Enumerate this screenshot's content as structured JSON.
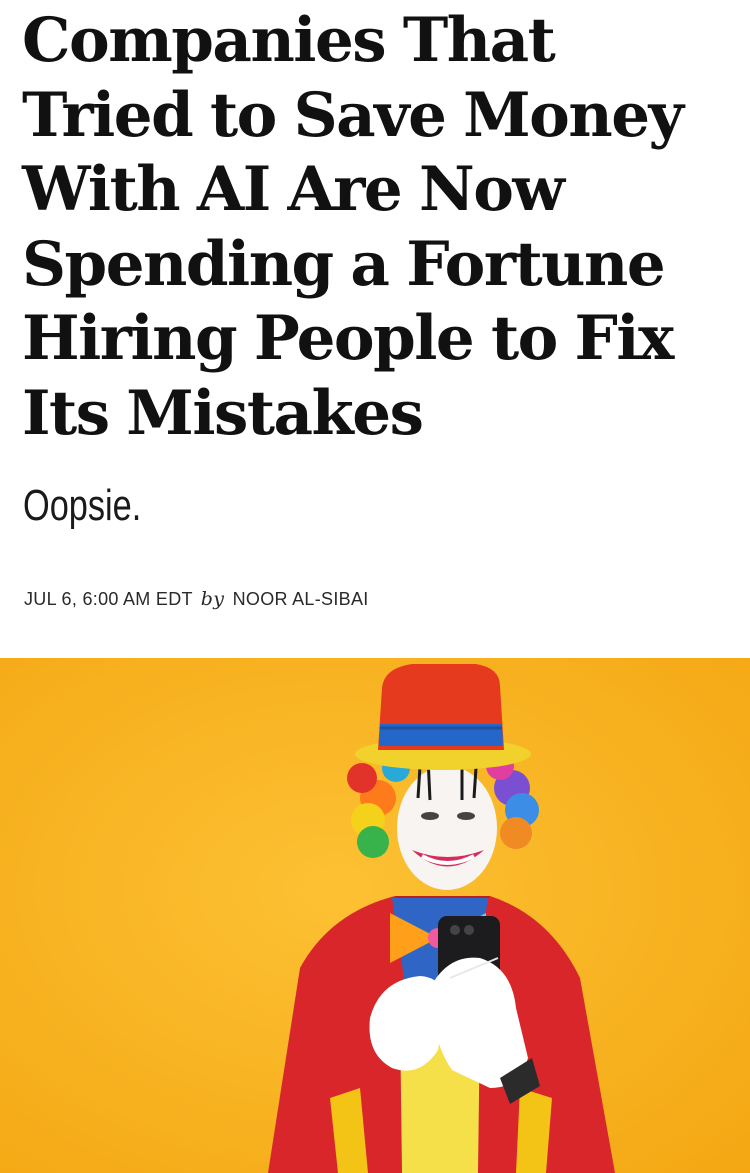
{
  "article": {
    "headline_lines": [
      "Companies That",
      "Tried to Save Money",
      "With AI Are Now",
      "Spending a Fortune",
      "Hiring People to Fix",
      "Its Mistakes"
    ],
    "dek": "Oopsie.",
    "byline": {
      "date": "JUL 6, 6:00 AM EDT",
      "by": "by",
      "author": "NOOR AL-SIBAI"
    }
  },
  "hero_image": {
    "subject": "clown-holding-smartphone",
    "background_color": "#f7b21c"
  }
}
